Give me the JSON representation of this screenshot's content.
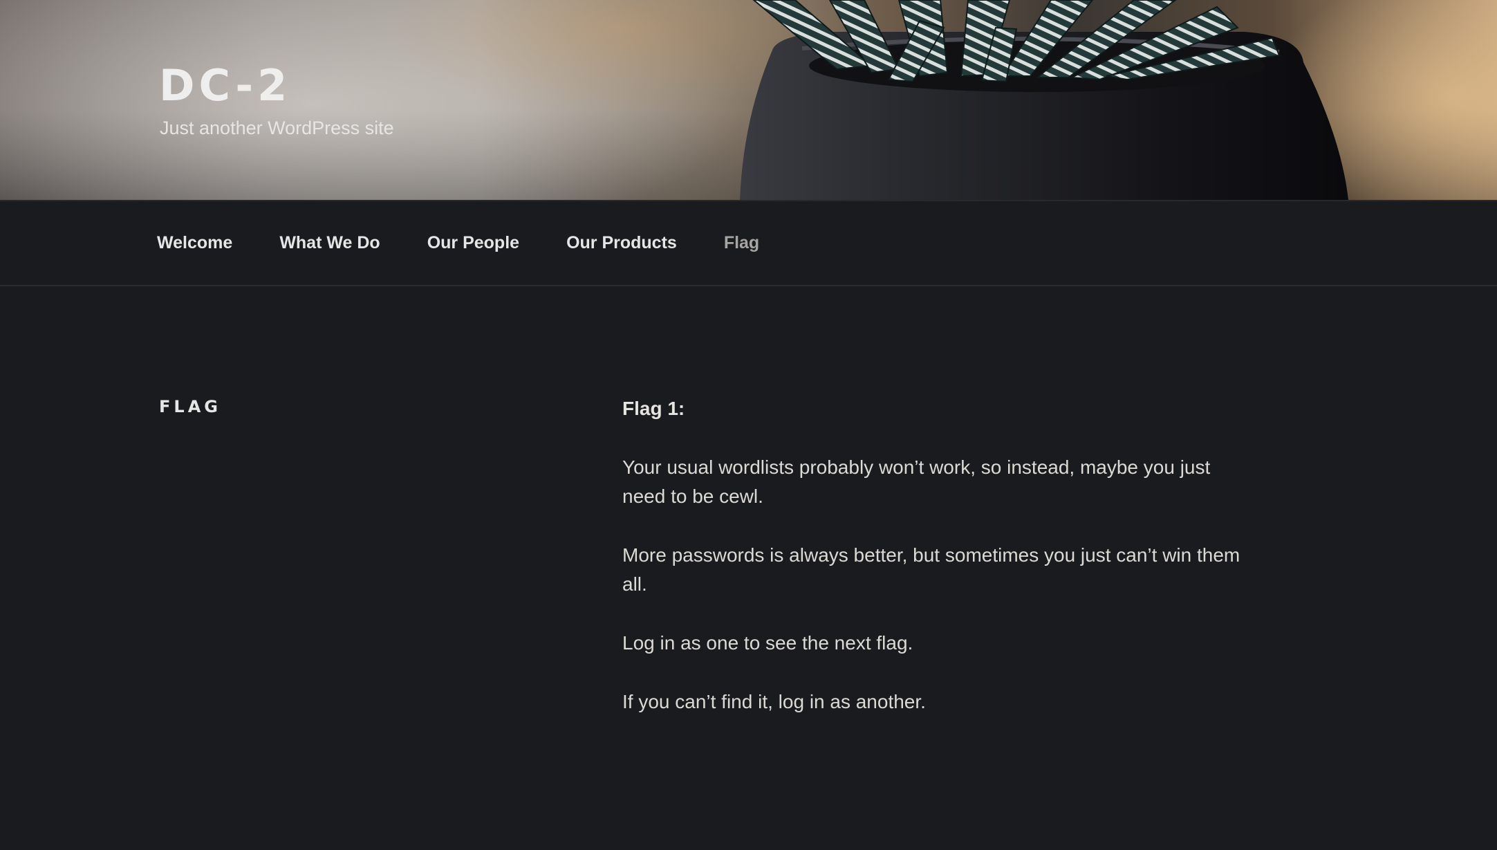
{
  "site": {
    "title": "DC-2",
    "tagline": "Just another WordPress site"
  },
  "nav": {
    "items": [
      {
        "label": "Welcome"
      },
      {
        "label": "What We Do"
      },
      {
        "label": "Our People"
      },
      {
        "label": "Our Products"
      },
      {
        "label": "Flag"
      }
    ],
    "current_item": "Flag"
  },
  "page": {
    "title": "FLAG",
    "content": {
      "heading": "Flag 1:",
      "paragraphs": [
        "Your usual wordlists probably won’t work, so instead, maybe you just need to be cewl.",
        "More passwords is always better, but sometimes you just can’t win them all.",
        "Log in as one to see the next flag.",
        "If you can’t find it, log in as another."
      ]
    }
  },
  "colors": {
    "background": "#1a1b1e",
    "text": "#dcdad5",
    "nav_current": "#a7a5a1"
  },
  "header_image": "potted zebra succulent in dark pot"
}
